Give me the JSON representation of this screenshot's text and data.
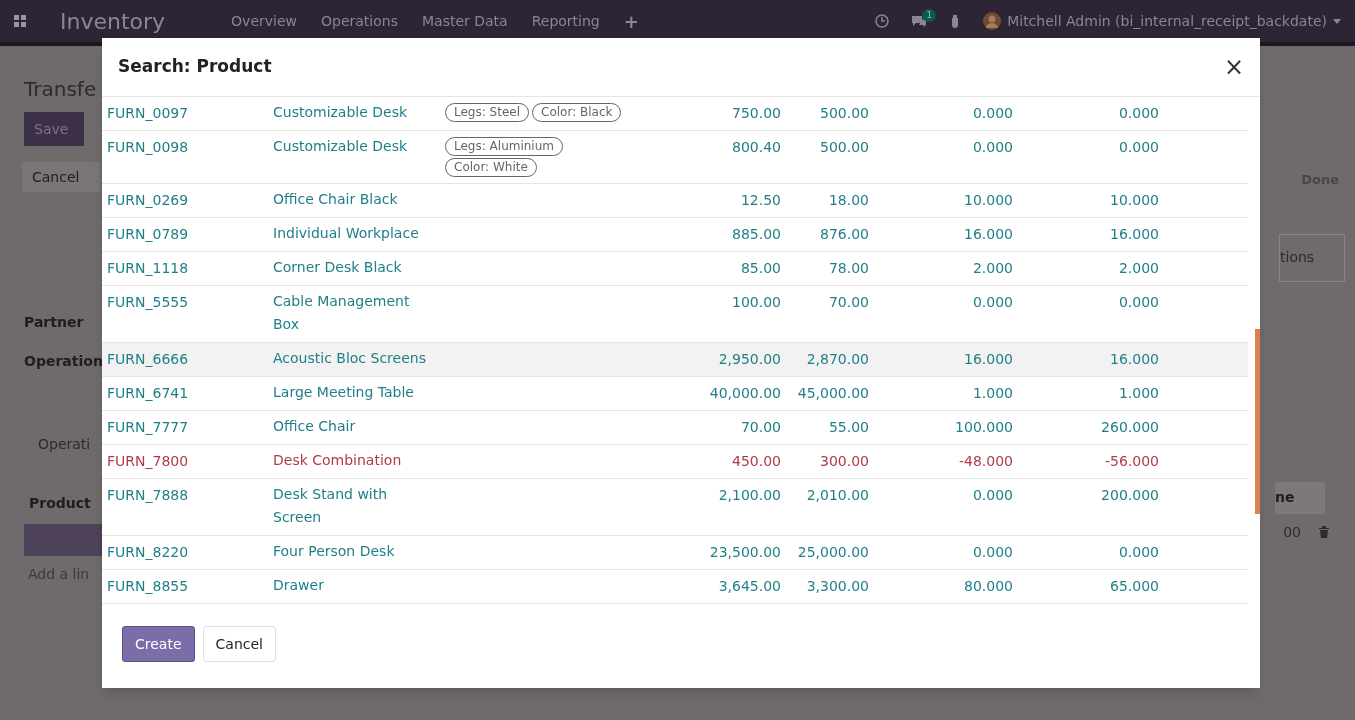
{
  "navbar": {
    "app": "Inventory",
    "menu": [
      "Overview",
      "Operations",
      "Master Data",
      "Reporting"
    ],
    "add": "+",
    "messages_badge": "1",
    "user": "Mitchell Admin (bi_internal_receipt_backdate)"
  },
  "background": {
    "title": "Transfe",
    "save": "Save",
    "cancel": "Cancel",
    "status": "Done",
    "smart_button": "tions",
    "labels": [
      "Partner",
      "Operation"
    ],
    "tab": "Operati",
    "product_header": "Product",
    "add_line": "Add a lin",
    "column_header": "ne",
    "cell": "00"
  },
  "dialog": {
    "title": "Search: Product",
    "close": "×",
    "rows": [
      {
        "code": "FURN_0097",
        "name": "Customizable Desk",
        "attributes": [
          "Legs: Steel",
          "Color: Black"
        ],
        "values": [
          "750.00",
          "500.00",
          "0.000",
          "0.000"
        ],
        "warning": false,
        "highlighted": false
      },
      {
        "code": "FURN_0098",
        "name": "Customizable Desk",
        "attributes": [
          "Legs: Aluminium",
          "Color: White"
        ],
        "values": [
          "800.40",
          "500.00",
          "0.000",
          "0.000"
        ],
        "warning": false,
        "highlighted": false
      },
      {
        "code": "FURN_0269",
        "name": "Office Chair Black",
        "values": [
          "12.50",
          "18.00",
          "10.000",
          "10.000"
        ],
        "warning": false,
        "highlighted": false
      },
      {
        "code": "FURN_0789",
        "name": "Individual Workplace",
        "values": [
          "885.00",
          "876.00",
          "16.000",
          "16.000"
        ],
        "warning": false,
        "highlighted": false
      },
      {
        "code": "FURN_1118",
        "name": "Corner Desk Black",
        "values": [
          "85.00",
          "78.00",
          "2.000",
          "2.000"
        ],
        "warning": false,
        "highlighted": false
      },
      {
        "code": "FURN_5555",
        "name": "Cable Management Box",
        "values": [
          "100.00",
          "70.00",
          "0.000",
          "0.000"
        ],
        "warning": false,
        "highlighted": false
      },
      {
        "code": "FURN_6666",
        "name": "Acoustic Bloc Screens",
        "values": [
          "2,950.00",
          "2,870.00",
          "16.000",
          "16.000"
        ],
        "warning": false,
        "highlighted": true
      },
      {
        "code": "FURN_6741",
        "name": "Large Meeting Table",
        "values": [
          "40,000.00",
          "45,000.00",
          "1.000",
          "1.000"
        ],
        "warning": false,
        "highlighted": false
      },
      {
        "code": "FURN_7777",
        "name": "Office Chair",
        "values": [
          "70.00",
          "55.00",
          "100.000",
          "260.000"
        ],
        "warning": false,
        "highlighted": false
      },
      {
        "code": "FURN_7800",
        "name": "Desk Combination",
        "values": [
          "450.00",
          "300.00",
          "-48.000",
          "-56.000"
        ],
        "warning": true,
        "highlighted": false
      },
      {
        "code": "FURN_7888",
        "name": "Desk Stand with Screen",
        "values": [
          "2,100.00",
          "2,010.00",
          "0.000",
          "200.000"
        ],
        "warning": false,
        "highlighted": false
      },
      {
        "code": "FURN_8220",
        "name": "Four Person Desk",
        "values": [
          "23,500.00",
          "25,000.00",
          "0.000",
          "0.000"
        ],
        "warning": false,
        "highlighted": false
      },
      {
        "code": "FURN_8855",
        "name": "Drawer",
        "values": [
          "3,645.00",
          "3,300.00",
          "80.000",
          "65.000"
        ],
        "warning": false,
        "highlighted": false
      }
    ],
    "buttons": [
      {
        "label": "Create",
        "kind": "primary"
      },
      {
        "label": "Cancel",
        "kind": "secondary"
      }
    ]
  }
}
